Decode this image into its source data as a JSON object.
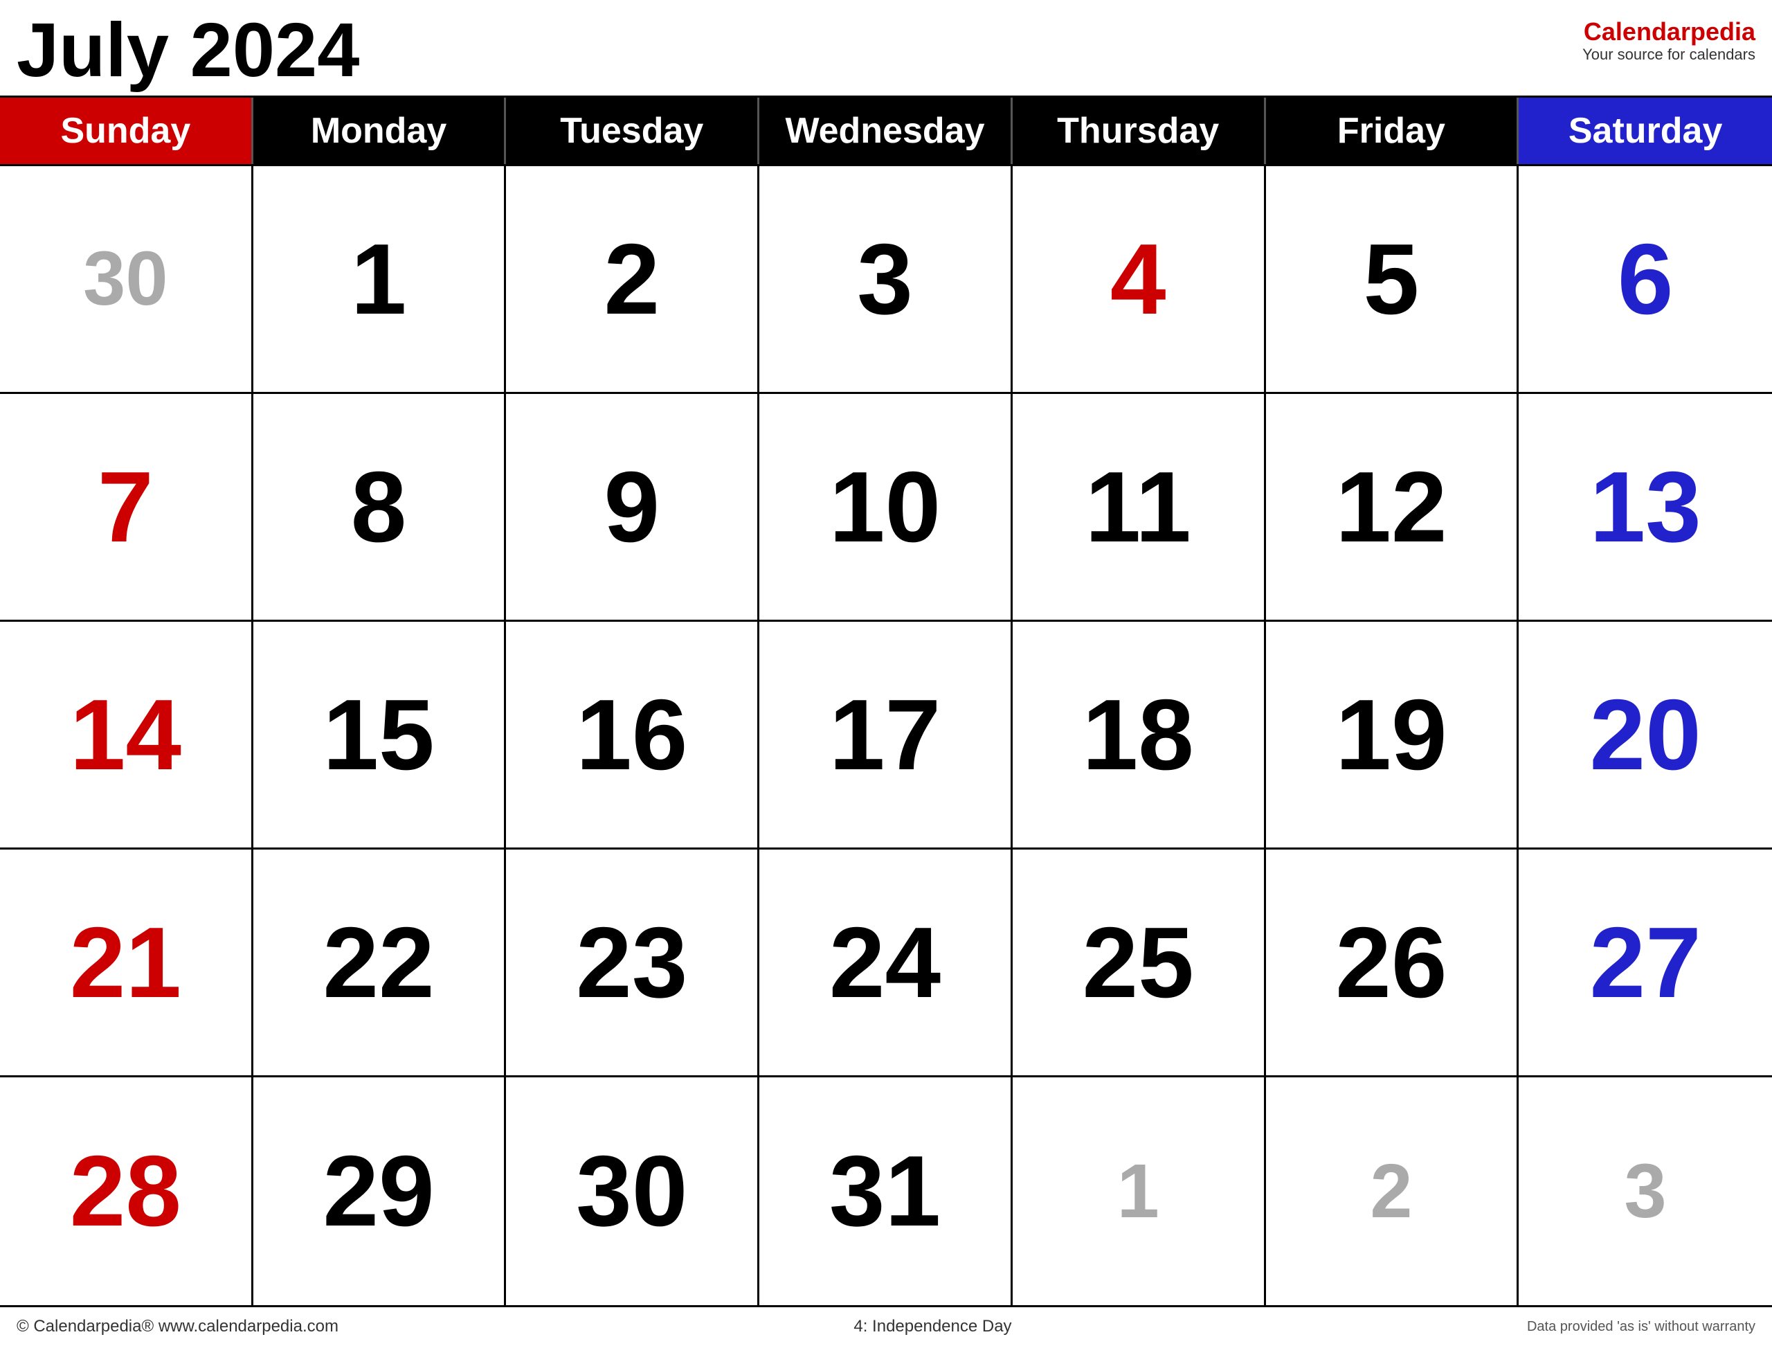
{
  "header": {
    "month_year": "July 2024",
    "brand_name_part1": "Calendar",
    "brand_name_part2": "pedia",
    "brand_tagline": "Your source for calendars"
  },
  "day_headers": [
    {
      "label": "Sunday",
      "type": "sunday"
    },
    {
      "label": "Monday",
      "type": "weekday"
    },
    {
      "label": "Tuesday",
      "type": "weekday"
    },
    {
      "label": "Wednesday",
      "type": "weekday"
    },
    {
      "label": "Thursday",
      "type": "weekday"
    },
    {
      "label": "Friday",
      "type": "weekday"
    },
    {
      "label": "Saturday",
      "type": "saturday"
    }
  ],
  "weeks": [
    [
      {
        "day": "30",
        "type": "other-month"
      },
      {
        "day": "1",
        "type": "weekday"
      },
      {
        "day": "2",
        "type": "weekday"
      },
      {
        "day": "3",
        "type": "weekday"
      },
      {
        "day": "4",
        "type": "holiday"
      },
      {
        "day": "5",
        "type": "weekday"
      },
      {
        "day": "6",
        "type": "saturday"
      }
    ],
    [
      {
        "day": "7",
        "type": "sunday"
      },
      {
        "day": "8",
        "type": "weekday"
      },
      {
        "day": "9",
        "type": "weekday"
      },
      {
        "day": "10",
        "type": "weekday"
      },
      {
        "day": "11",
        "type": "weekday"
      },
      {
        "day": "12",
        "type": "weekday"
      },
      {
        "day": "13",
        "type": "saturday"
      }
    ],
    [
      {
        "day": "14",
        "type": "sunday"
      },
      {
        "day": "15",
        "type": "weekday"
      },
      {
        "day": "16",
        "type": "weekday"
      },
      {
        "day": "17",
        "type": "weekday"
      },
      {
        "day": "18",
        "type": "weekday"
      },
      {
        "day": "19",
        "type": "weekday"
      },
      {
        "day": "20",
        "type": "saturday"
      }
    ],
    [
      {
        "day": "21",
        "type": "sunday"
      },
      {
        "day": "22",
        "type": "weekday"
      },
      {
        "day": "23",
        "type": "weekday"
      },
      {
        "day": "24",
        "type": "weekday"
      },
      {
        "day": "25",
        "type": "weekday"
      },
      {
        "day": "26",
        "type": "weekday"
      },
      {
        "day": "27",
        "type": "saturday"
      }
    ],
    [
      {
        "day": "28",
        "type": "sunday"
      },
      {
        "day": "29",
        "type": "weekday"
      },
      {
        "day": "30",
        "type": "weekday"
      },
      {
        "day": "31",
        "type": "weekday"
      },
      {
        "day": "1",
        "type": "other-month"
      },
      {
        "day": "2",
        "type": "other-month"
      },
      {
        "day": "3",
        "type": "other-month"
      }
    ]
  ],
  "footer": {
    "left": "© Calendarpedia®   www.calendarpedia.com",
    "center": "4: Independence Day",
    "right": "Data provided 'as is' without warranty"
  }
}
